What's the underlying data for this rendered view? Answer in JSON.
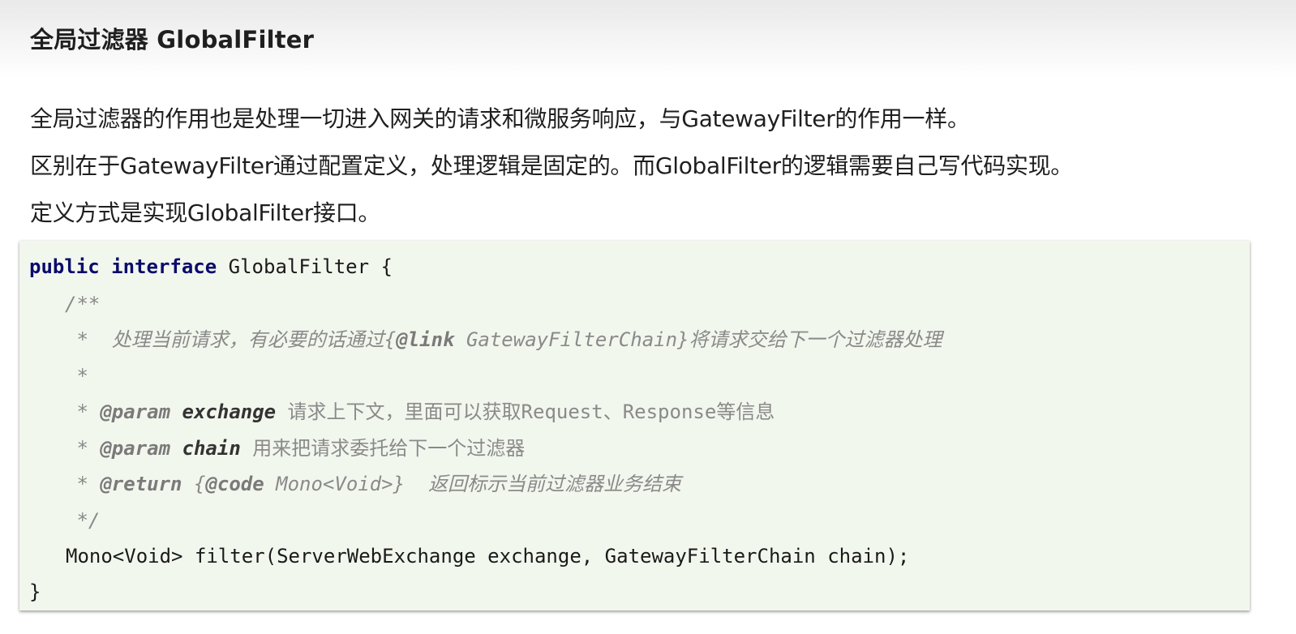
{
  "title": "全局过滤器 GlobalFilter",
  "paragraphs": [
    "全局过滤器的作用也是处理一切进入网关的请求和微服务响应，与GatewayFilter的作用一样。",
    "区别在于GatewayFilter通过配置定义，处理逻辑是固定的。而GlobalFilter的逻辑需要自己写代码实现。",
    "定义方式是实现GlobalFilter接口。"
  ],
  "code": {
    "line1": {
      "kw_public": "public",
      "kw_interface": "interface",
      "rest": " GlobalFilter {"
    },
    "line2": "/**",
    "line3": {
      "prefix": " *  处理当前请求，有必要的话通过{",
      "tag": "@link",
      "middle": " GatewayFilterChain}",
      "suffix": "将请求交给下一个过滤器处理"
    },
    "line4": " *",
    "line5": {
      "prefix": " * ",
      "tag": "@param",
      "name": "exchange",
      "desc": " 请求上下文，里面可以获取Request、Response等信息"
    },
    "line6": {
      "prefix": " * ",
      "tag": "@param",
      "name": "chain",
      "desc": " 用来把请求委托给下一个过滤器"
    },
    "line7": {
      "prefix": " * ",
      "tag": "@return",
      "open": " {",
      "code_tag": "@code",
      "code_val": " Mono<Void>}",
      "desc": "  返回标示当前过滤器业务结束"
    },
    "line8": " */",
    "line9": "Mono<Void> filter(ServerWebExchange exchange, GatewayFilterChain chain);",
    "line10": "}"
  }
}
